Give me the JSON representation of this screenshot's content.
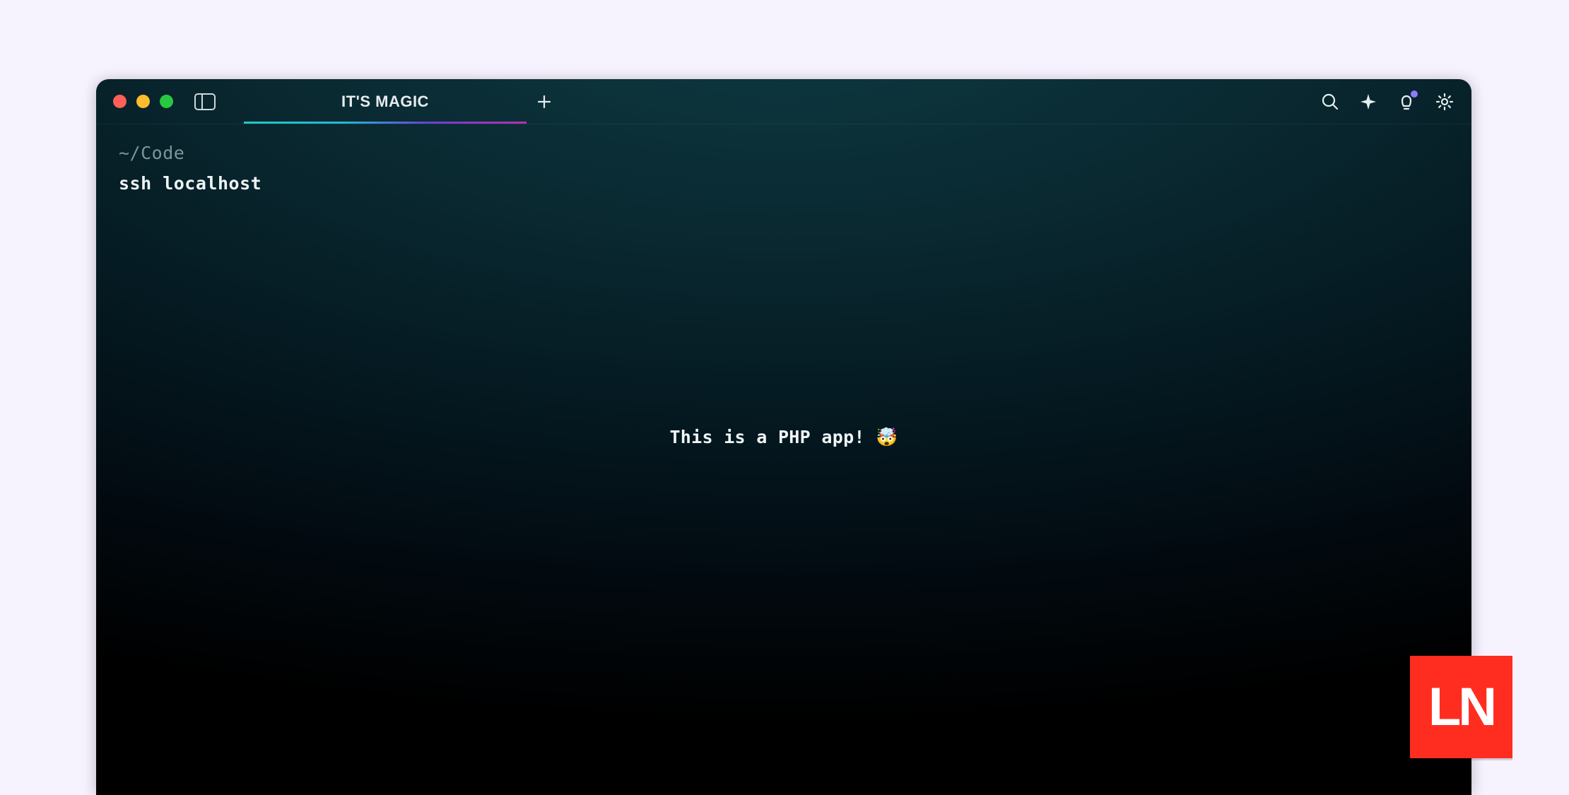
{
  "window": {
    "traffic": {
      "close": "close",
      "minimize": "minimize",
      "zoom": "zoom"
    },
    "tab_title": "IT'S MAGIC"
  },
  "terminal": {
    "cwd": "~/Code",
    "command": "ssh localhost",
    "center_message": "This is a PHP app! 🤯"
  },
  "logo": {
    "text": "LN"
  },
  "icons": {
    "panel": "panel-icon",
    "new_tab": "plus-icon",
    "search": "search-icon",
    "sparkle": "sparkle-icon",
    "bulb": "bulb-icon",
    "gear": "gear-icon"
  }
}
